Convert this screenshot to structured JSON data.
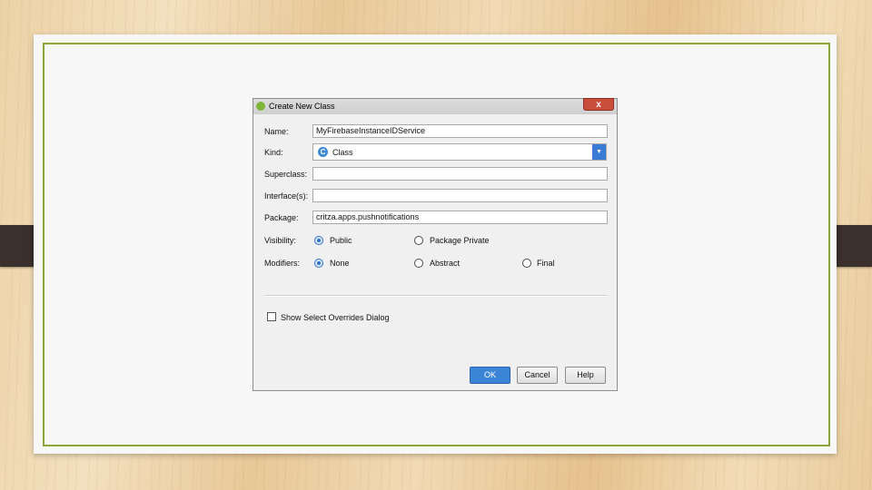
{
  "dialog": {
    "title": "Create New Class",
    "close_glyph": "x",
    "fields": {
      "name_label": "Name:",
      "name_value": "MyFirebaseInstanceIDService",
      "kind_label": "Kind:",
      "kind_value": "Class",
      "kind_icon_glyph": "C",
      "superclass_label": "Superclass:",
      "superclass_value": "",
      "interfaces_label": "Interface(s):",
      "interfaces_value": "",
      "package_label": "Package:",
      "package_value": "critza.apps.pushnotifications"
    },
    "visibility": {
      "label": "Visibility:",
      "options": [
        "Public",
        "Package Private"
      ],
      "selected": "Public"
    },
    "modifiers": {
      "label": "Modifiers:",
      "options": [
        "None",
        "Abstract",
        "Final"
      ],
      "selected": "None"
    },
    "show_overrides_label": "Show Select Overrides Dialog",
    "show_overrides_checked": false,
    "buttons": {
      "ok": "OK",
      "cancel": "Cancel",
      "help": "Help"
    }
  },
  "colors": {
    "accent": "#3c84d6",
    "frame": "#8aa53a",
    "close": "#c94f3c"
  }
}
